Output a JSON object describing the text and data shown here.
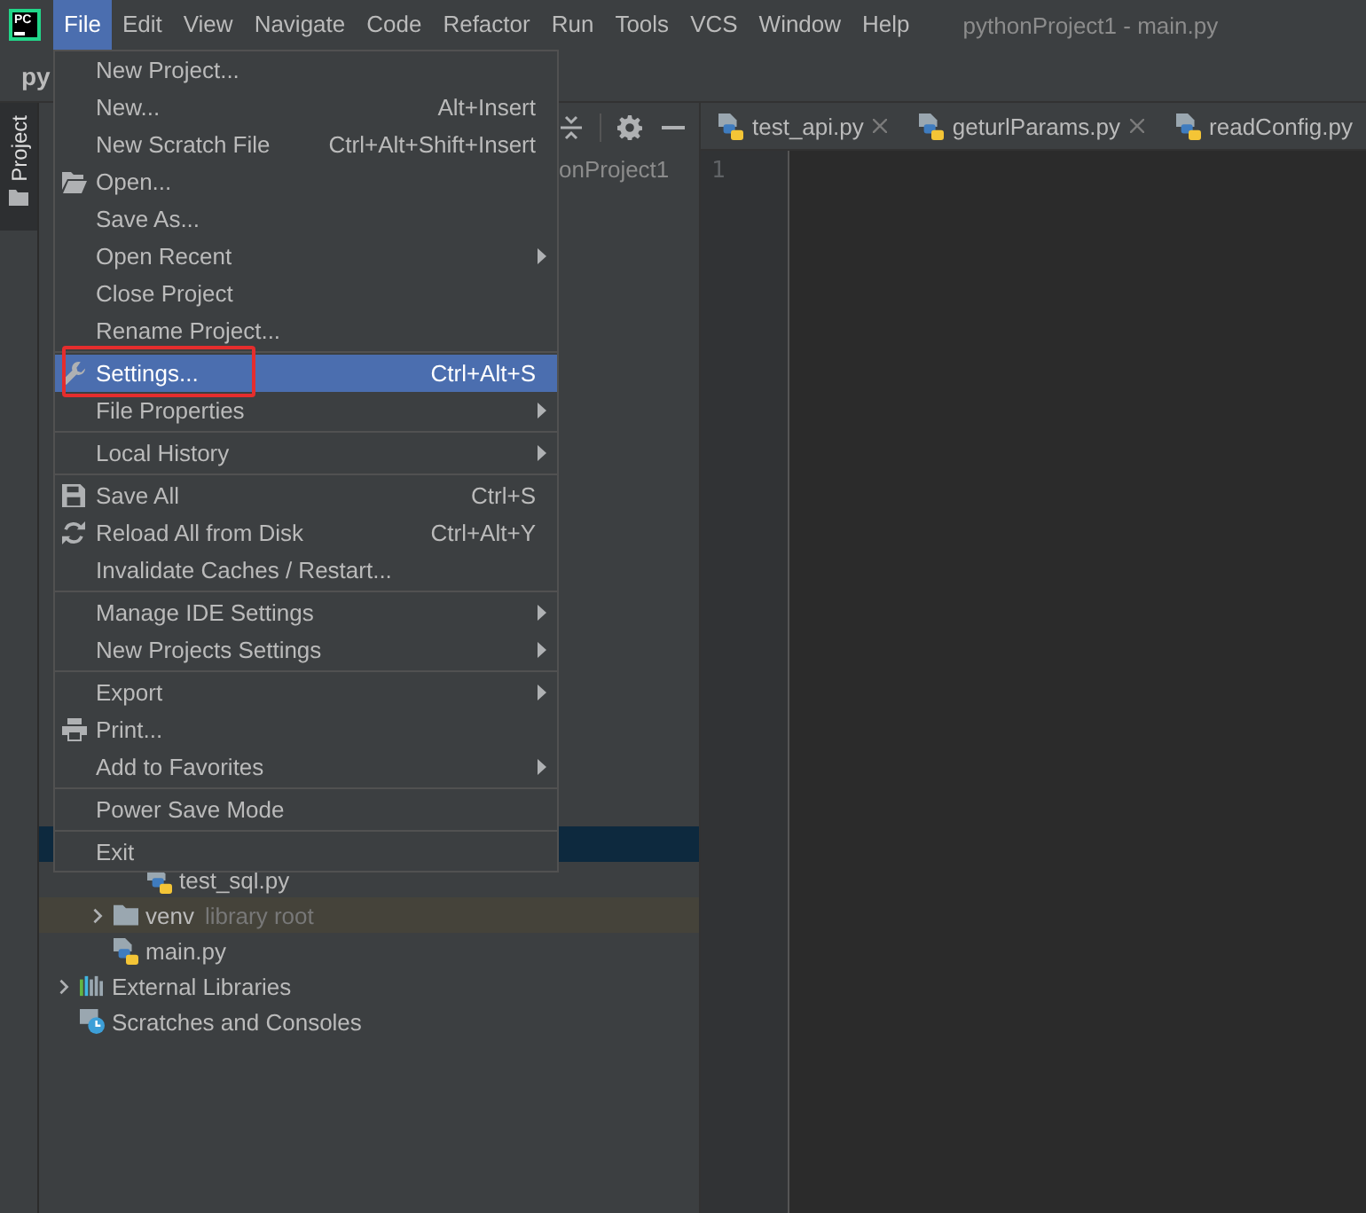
{
  "app_icon": {
    "text": "PC"
  },
  "menu_bar": [
    {
      "label": "File",
      "selected": true
    },
    {
      "label": "Edit",
      "selected": false
    },
    {
      "label": "View",
      "selected": false
    },
    {
      "label": "Navigate",
      "selected": false
    },
    {
      "label": "Code",
      "selected": false
    },
    {
      "label": "Refactor",
      "selected": false
    },
    {
      "label": "Run",
      "selected": false
    },
    {
      "label": "Tools",
      "selected": false
    },
    {
      "label": "VCS",
      "selected": false
    },
    {
      "label": "Window",
      "selected": false
    },
    {
      "label": "Help",
      "selected": false
    }
  ],
  "window": {
    "title": "pythonProject1 - main.py"
  },
  "navigation_bar": {
    "breadcrumb": "py"
  },
  "tool_window_strip": {
    "tabs": [
      {
        "label": "Project",
        "selected": true
      }
    ]
  },
  "project_panel": {
    "tree": [
      {
        "label": "onProject1",
        "kind": "project",
        "selected": false,
        "children": [
          {
            "kind": "covered",
            "children": [
              {
                "kind": "hidden-item",
                "selected": true
              },
              {
                "label": "test_sql.py",
                "kind": "python-file",
                "selected": false
              }
            ]
          },
          {
            "label": "venv",
            "hint": "library root",
            "kind": "folder",
            "expanded": false,
            "selected": false,
            "color": "#45433a"
          },
          {
            "label": "main.py",
            "kind": "python-file",
            "selected": false
          }
        ]
      },
      {
        "label": "External Libraries",
        "kind": "libraries",
        "expanded": false,
        "selected": false
      },
      {
        "label": "Scratches and Consoles",
        "kind": "scratches",
        "selected": false
      }
    ]
  },
  "editor": {
    "tabs": [
      {
        "label": "test_api.py",
        "selected": false,
        "show_close": true
      },
      {
        "label": "geturlParams.py",
        "selected": false,
        "show_close": true
      },
      {
        "label": "readConfig.py",
        "selected": false,
        "show_close": false
      }
    ],
    "line_numbers": [
      "1"
    ]
  },
  "file_menu": {
    "groups": [
      {
        "items": [
          {
            "label": "New Project...",
            "selected": false,
            "submenu": false,
            "outlined": false
          },
          {
            "label": "New...",
            "shortcut": "Alt+Insert",
            "selected": false,
            "submenu": false,
            "outlined": false
          },
          {
            "label": "New Scratch File",
            "shortcut": "Ctrl+Alt+Shift+Insert",
            "selected": false,
            "submenu": false,
            "outlined": false
          },
          {
            "label": "Open...",
            "selected": false,
            "submenu": false,
            "outlined": false
          },
          {
            "label": "Save As...",
            "selected": false,
            "submenu": false,
            "outlined": false
          },
          {
            "label": "Open Recent",
            "selected": false,
            "submenu": true,
            "outlined": false
          },
          {
            "label": "Close Project",
            "selected": false,
            "submenu": false,
            "outlined": false
          },
          {
            "label": "Rename Project...",
            "selected": false,
            "submenu": false,
            "outlined": false
          }
        ]
      },
      {
        "items": [
          {
            "label": "Settings...",
            "shortcut": "Ctrl+Alt+S",
            "selected": true,
            "submenu": false,
            "outlined": true
          },
          {
            "label": "File Properties",
            "selected": false,
            "submenu": true,
            "outlined": false
          }
        ]
      },
      {
        "items": [
          {
            "label": "Local History",
            "selected": false,
            "submenu": true,
            "outlined": false
          }
        ]
      },
      {
        "items": [
          {
            "label": "Save All",
            "shortcut": "Ctrl+S",
            "selected": false,
            "submenu": false,
            "outlined": false
          },
          {
            "label": "Reload All from Disk",
            "shortcut": "Ctrl+Alt+Y",
            "selected": false,
            "submenu": false,
            "outlined": false
          },
          {
            "label": "Invalidate Caches / Restart...",
            "selected": false,
            "submenu": false,
            "outlined": false
          }
        ]
      },
      {
        "items": [
          {
            "label": "Manage IDE Settings",
            "selected": false,
            "submenu": true,
            "outlined": false
          },
          {
            "label": "New Projects Settings",
            "selected": false,
            "submenu": true,
            "outlined": false
          }
        ]
      },
      {
        "items": [
          {
            "label": "Export",
            "selected": false,
            "submenu": true,
            "outlined": false
          },
          {
            "label": "Print...",
            "selected": false,
            "submenu": false,
            "outlined": false
          },
          {
            "label": "Add to Favorites",
            "selected": false,
            "submenu": true,
            "outlined": false
          }
        ]
      },
      {
        "items": [
          {
            "label": "Power Save Mode",
            "selected": false,
            "submenu": false,
            "outlined": false
          }
        ]
      },
      {
        "items": [
          {
            "label": "Exit",
            "selected": false,
            "submenu": false,
            "outlined": false
          }
        ]
      }
    ]
  }
}
